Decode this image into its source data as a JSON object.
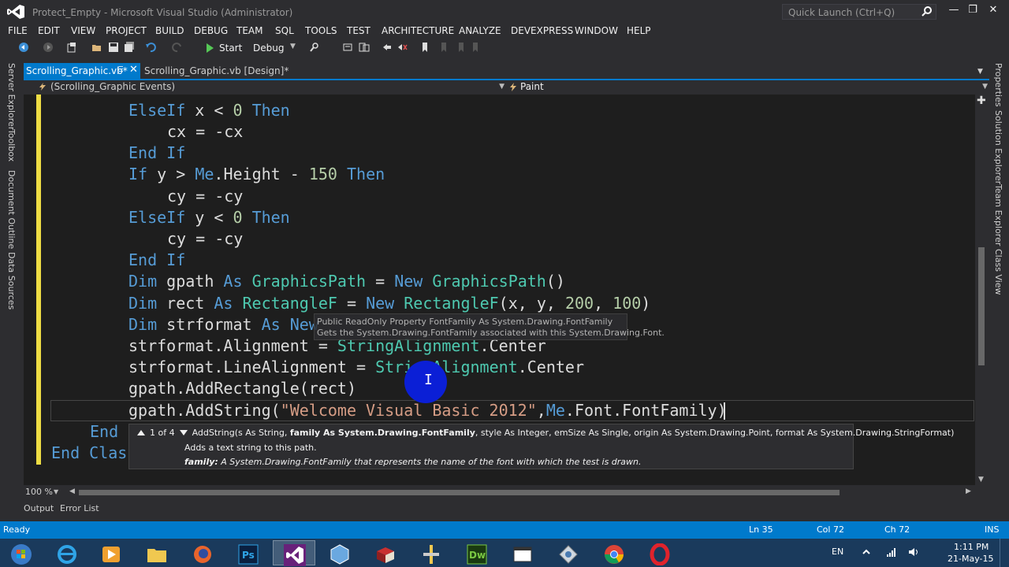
{
  "window": {
    "title": "Protect_Empty - Microsoft Visual Studio (Administrator)",
    "quick_launch_placeholder": "Quick Launch (Ctrl+Q)"
  },
  "menu": [
    "FILE",
    "EDIT",
    "VIEW",
    "PROJECT",
    "BUILD",
    "DEBUG",
    "TEAM",
    "SQL",
    "TOOLS",
    "TEST",
    "ARCHITECTURE",
    "ANALYZE",
    "DEVEXPRESS",
    "WINDOW",
    "HELP"
  ],
  "toolbar": {
    "start_label": "Start",
    "config_label": "Debug"
  },
  "left_tabs": [
    "Server Explorer",
    "Toolbox",
    "Document Outline",
    "Data Sources"
  ],
  "right_tabs": [
    "Properties",
    "Solution Explorer",
    "Team Explorer",
    "Class View"
  ],
  "doc_tabs": {
    "active": "Scrolling_Graphic.vb*",
    "inactive": "Scrolling_Graphic.vb [Design]*"
  },
  "navbar": {
    "left": "(Scrolling_Graphic Events)",
    "right": "Paint"
  },
  "code_lines": [
    "ElseIf x < 0 Then",
    "cx = -cx",
    "End If",
    "If y > Me.Height - 150 Then",
    "cy = -cy",
    "ElseIf y < 0 Then",
    "cy = -cy",
    "End If",
    "Dim gpath As GraphicsPath = New GraphicsPath()",
    "Dim rect As RectangleF = New RectangleF(x, y, 200, 100)",
    "Dim strformat As New",
    "strformat.Alignment = StringAlignment.Center",
    "strformat.LineAlignment = StringAlignment.Center",
    "gpath.AddRectangle(rect)",
    "gpath.AddString(\"Welcome Visual Basic 2012\",Me.Font.FontFamily)",
    "End",
    "End Clas"
  ],
  "quick_info": {
    "line1": "Public ReadOnly Property FontFamily As System.Drawing.FontFamily",
    "line2": "Gets the System.Drawing.FontFamily associated with this System.Drawing.Font."
  },
  "signature_help": {
    "counter": "1 of 4",
    "sig_prefix": "AddString(s As String, ",
    "sig_bold": "family As System.Drawing.FontFamily",
    "sig_suffix": ", style As Integer, emSize As Single, origin As System.Drawing.Point, format As System.Drawing.StringFormat)",
    "summary": "Adds a text string to this path.",
    "param_name": "family:",
    "param_desc": " A System.Drawing.FontFamily that represents the name of the font with which the test is drawn."
  },
  "editor": {
    "zoom": "100 %"
  },
  "bottom_tabs": [
    "Output",
    "Error List"
  ],
  "status": {
    "state": "Ready",
    "line": "Ln 35",
    "col": "Col 72",
    "ch": "Ch 72",
    "mode": "INS"
  },
  "taskbar": {
    "lang": "EN",
    "time": "1:11 PM",
    "date": "21-May-15"
  },
  "colors": {
    "accent": "#007acc",
    "keyword": "#569cd6",
    "type": "#4ec9b0",
    "number": "#b5cea8",
    "string": "#d69d85",
    "editor_bg": "#1e1e1e"
  }
}
